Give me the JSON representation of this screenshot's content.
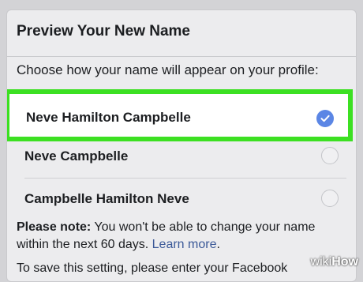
{
  "dialog": {
    "title": "Preview Your New Name",
    "instruction": "Choose how your name will appear on your profile:"
  },
  "options": [
    {
      "label": "Neve Hamilton Campbelle",
      "selected": true
    },
    {
      "label": "Neve Campbelle",
      "selected": false
    },
    {
      "label": "Campbelle Hamilton Neve",
      "selected": false
    }
  ],
  "note": {
    "prefix": "Please note:",
    "body": " You won't be able to change your name within the next 60 days. ",
    "link": "Learn more",
    "suffix": "."
  },
  "save_prompt": "To save this setting, please enter your Facebook",
  "watermark": {
    "wiki": "wiki",
    "how": "How"
  },
  "colors": {
    "highlight": "#3ce022",
    "check_accent": "#5b86e5",
    "link": "#3b5998"
  }
}
